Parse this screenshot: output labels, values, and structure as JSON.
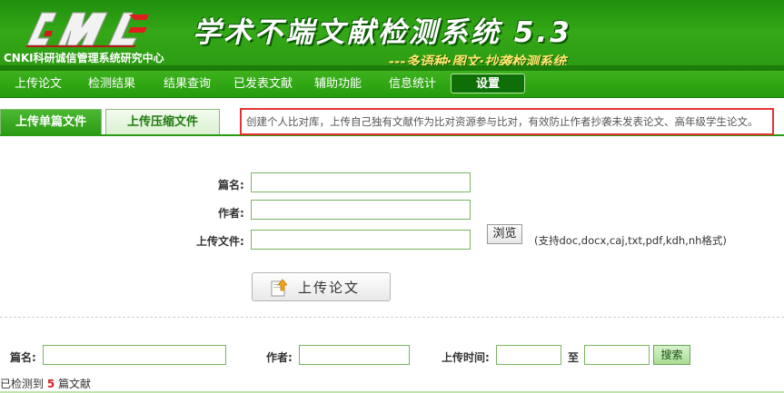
{
  "header": {
    "logo_alt": "AMLC",
    "org_name": "CNKI科研诚信管理系统研究中心",
    "system_title": "学术不端文献检测系统 5.3",
    "slogan": "---多语种·图文·抄袭检测系统"
  },
  "nav": {
    "items": [
      {
        "label": "上传论文",
        "active": false
      },
      {
        "label": "检测结果",
        "active": false
      },
      {
        "label": "结果查询",
        "active": false
      },
      {
        "label": "已发表文献",
        "active": false
      },
      {
        "label": "辅助功能",
        "active": false
      },
      {
        "label": "信息统计",
        "active": false
      },
      {
        "label": "设置",
        "active": true
      }
    ]
  },
  "tabs": {
    "single": "上传单篇文件",
    "archive": "上传压缩文件"
  },
  "notice": "创建个人比对库，上传自己独有文献作为比对资源参与比对，有效防止作者抄袭未发表论文、高年级学生论文。",
  "upload_form": {
    "title_label": "篇名:",
    "title_value": "",
    "author_label": "作者:",
    "author_value": "",
    "file_label": "上传文件:",
    "file_value": "",
    "browse_label": "浏览",
    "formats_note": "(支持doc,docx,caj,txt,pdf,kdh,nh格式)",
    "upload_button": "上传论文",
    "upload_icon": "upload-arrow-icon"
  },
  "search": {
    "title_label": "篇名:",
    "author_label": "作者:",
    "time_label": "上传时间:",
    "to_label": "至",
    "button": "搜索"
  },
  "result": {
    "prefix": "已检测到",
    "count": "5",
    "suffix": "篇文献"
  },
  "colors": {
    "brand_green": "#2c9a12",
    "nav_active": "#0e6e08",
    "notice_border": "#e53333",
    "count_red": "#d62020"
  }
}
